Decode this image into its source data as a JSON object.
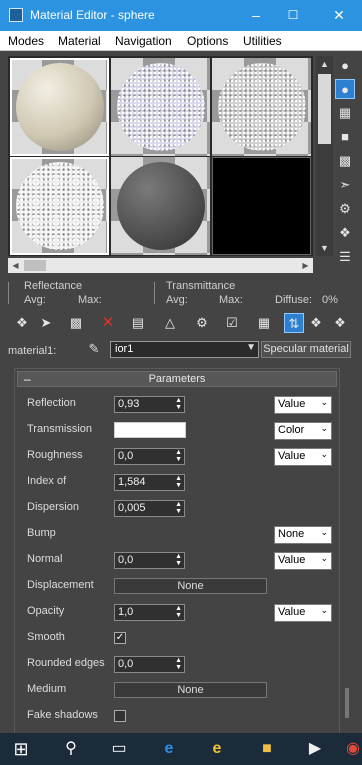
{
  "window": {
    "title": "Material Editor - sphere",
    "minimize_icon": "minimize-icon",
    "maximize_icon": "maximize-icon",
    "close_icon": "close-icon"
  },
  "menu": [
    "Modes",
    "Material",
    "Navigation",
    "Options",
    "Utilities"
  ],
  "slots": [
    {
      "material": "beige-diffuse",
      "color": "#d8d2bf",
      "selected": true
    },
    {
      "material": "noisy-blue",
      "color": "#cfd0e8",
      "selected": false
    },
    {
      "material": "noisy-gray",
      "color": "#c8c8c8",
      "selected": false
    },
    {
      "material": "noisy-white",
      "color": "#e8e8e8",
      "selected": true
    },
    {
      "material": "dark-gray",
      "color": "#5a5a5a",
      "selected": false
    },
    {
      "material": "empty",
      "color": "#000000",
      "selected": false
    }
  ],
  "info": {
    "reflectance_label": "Reflectance",
    "avg_label": "Avg:",
    "max_label": "Max:",
    "transmittance_label": "Transmittance",
    "avg2_label": "Avg:",
    "max2_label": "Max:",
    "diffuse_label": "Diffuse:",
    "diffuse_value": "0%"
  },
  "material_bar": {
    "label": "material1:",
    "name": "ior1",
    "type_button": "Specular material"
  },
  "parameters": {
    "title": "Parameters",
    "reflection": {
      "label": "Reflection",
      "value": "0,93",
      "mode": "Value"
    },
    "transmission": {
      "label": "Transmission",
      "color": "#ffffff",
      "mode": "Color"
    },
    "roughness": {
      "label": "Roughness",
      "value": "0,0",
      "mode": "Value"
    },
    "ior": {
      "label": "Index of",
      "value": "1,584"
    },
    "dispersion": {
      "label": "Dispersion",
      "value": "0,005"
    },
    "bump": {
      "label": "Bump",
      "mode": "None"
    },
    "normal": {
      "label": "Normal",
      "value": "0,0",
      "mode": "Value"
    },
    "displacement": {
      "label": "Displacement",
      "map": "None"
    },
    "opacity": {
      "label": "Opacity",
      "value": "1,0",
      "mode": "Value"
    },
    "smooth": {
      "label": "Smooth",
      "checked": true
    },
    "rounded_edges": {
      "label": "Rounded edges",
      "value": "0,0"
    },
    "medium": {
      "label": "Medium",
      "map": "None"
    },
    "fake_shadows": {
      "label": "Fake shadows",
      "checked": false
    }
  },
  "colors": {
    "title_bar": "#2b93e0",
    "panel": "#444444",
    "active_tool": "#2d7fd0",
    "taskbar": "#1c2b3a"
  }
}
